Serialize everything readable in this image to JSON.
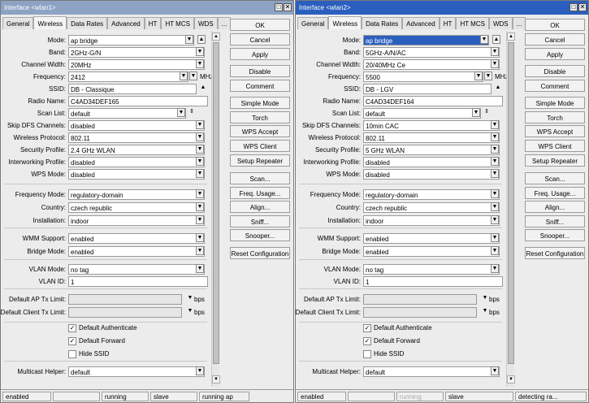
{
  "windows": [
    {
      "title": "Interface <wlan1>",
      "tabs": [
        "General",
        "Wireless",
        "Data Rates",
        "Advanced",
        "HT",
        "HT MCS",
        "WDS",
        "..."
      ],
      "active_tab": "Wireless",
      "fields": {
        "mode": {
          "label": "Mode:",
          "value": "ap bridge"
        },
        "band": {
          "label": "Band:",
          "value": "2GHz-G/N"
        },
        "channel_width": {
          "label": "Channel Width:",
          "value": "20MHz"
        },
        "frequency": {
          "label": "Frequency:",
          "value": "2412",
          "unit": "MHz"
        },
        "ssid": {
          "label": "SSID:",
          "value": "DB - Classique"
        },
        "radio_name": {
          "label": "Radio Name:",
          "value": "C4AD34DEF165"
        },
        "scan_list": {
          "label": "Scan List:",
          "value": "default"
        },
        "skip_dfs": {
          "label": "Skip DFS Channels:",
          "value": "disabled"
        },
        "wireless_protocol": {
          "label": "Wireless Protocol:",
          "value": "802.11"
        },
        "security_profile": {
          "label": "Security Profile:",
          "value": "2.4 GHz WLAN"
        },
        "interworking_profile": {
          "label": "Interworking Profile:",
          "value": "disabled"
        },
        "wps_mode": {
          "label": "WPS Mode:",
          "value": "disabled"
        },
        "frequency_mode": {
          "label": "Frequency Mode:",
          "value": "regulatory-domain"
        },
        "country": {
          "label": "Country:",
          "value": "czech republic"
        },
        "installation": {
          "label": "Installation:",
          "value": "indoor"
        },
        "wmm_support": {
          "label": "WMM Support:",
          "value": "enabled"
        },
        "bridge_mode": {
          "label": "Bridge Mode:",
          "value": "enabled"
        },
        "vlan_mode": {
          "label": "VLAN Mode:",
          "value": "no tag"
        },
        "vlan_id": {
          "label": "VLAN ID:",
          "value": "1"
        },
        "default_ap_tx_limit": {
          "label": "Default AP Tx Limit:",
          "value": "",
          "unit": "bps"
        },
        "default_client_tx_limit": {
          "label": "Default Client Tx Limit:",
          "value": "",
          "unit": "bps"
        },
        "multicast_helper": {
          "label": "Multicast Helper:",
          "value": "default"
        }
      },
      "checkboxes": {
        "default_authenticate": {
          "label": "Default Authenticate",
          "checked": true
        },
        "default_forward": {
          "label": "Default Forward",
          "checked": true
        },
        "hide_ssid": {
          "label": "Hide SSID",
          "checked": false
        }
      },
      "buttons": {
        "ok": "OK",
        "cancel": "Cancel",
        "apply": "Apply",
        "disable": "Disable",
        "comment": "Comment",
        "simple_mode": "Simple Mode",
        "torch": "Torch",
        "wps_accept": "WPS Accept",
        "wps_client": "WPS Client",
        "setup_repeater": "Setup Repeater",
        "scan": "Scan...",
        "freq_usage": "Freq. Usage...",
        "align": "Align...",
        "sniff": "Sniff...",
        "snooper": "Snooper...",
        "reset_configuration": "Reset Configuration"
      },
      "status": [
        "enabled",
        "",
        "running",
        "slave",
        "running ap"
      ]
    },
    {
      "title": "Interface <wlan2>",
      "tabs": [
        "General",
        "Wireless",
        "Data Rates",
        "Advanced",
        "HT",
        "HT MCS",
        "WDS",
        "..."
      ],
      "active_tab": "Wireless",
      "fields": {
        "mode": {
          "label": "Mode:",
          "value": "ap bridge"
        },
        "band": {
          "label": "Band:",
          "value": "5GHz-A/N/AC"
        },
        "channel_width": {
          "label": "Channel Width:",
          "value": "20/40MHz Ce"
        },
        "frequency": {
          "label": "Frequency:",
          "value": "5500",
          "unit": "MHz"
        },
        "ssid": {
          "label": "SSID:",
          "value": "DB - LGV"
        },
        "radio_name": {
          "label": "Radio Name:",
          "value": "C4AD34DEF164"
        },
        "scan_list": {
          "label": "Scan List:",
          "value": "default"
        },
        "skip_dfs": {
          "label": "Skip DFS Channels:",
          "value": "10min CAC"
        },
        "wireless_protocol": {
          "label": "Wireless Protocol:",
          "value": "802.11"
        },
        "security_profile": {
          "label": "Security Profile:",
          "value": "5 GHz WLAN"
        },
        "interworking_profile": {
          "label": "Interworking Profile:",
          "value": "disabled"
        },
        "wps_mode": {
          "label": "WPS Mode:",
          "value": "disabled"
        },
        "frequency_mode": {
          "label": "Frequency Mode:",
          "value": "regulatory-domain"
        },
        "country": {
          "label": "Country:",
          "value": "czech republic"
        },
        "installation": {
          "label": "Installation:",
          "value": "indoor"
        },
        "wmm_support": {
          "label": "WMM Support:",
          "value": "enabled"
        },
        "bridge_mode": {
          "label": "Bridge Mode:",
          "value": "enabled"
        },
        "vlan_mode": {
          "label": "VLAN Mode:",
          "value": "no tag"
        },
        "vlan_id": {
          "label": "VLAN ID:",
          "value": "1"
        },
        "default_ap_tx_limit": {
          "label": "Default AP Tx Limit:",
          "value": "",
          "unit": "bps"
        },
        "default_client_tx_limit": {
          "label": "Default Client Tx Limit:",
          "value": "",
          "unit": "bps"
        },
        "multicast_helper": {
          "label": "Multicast Helper:",
          "value": "default"
        }
      },
      "checkboxes": {
        "default_authenticate": {
          "label": "Default Authenticate",
          "checked": true
        },
        "default_forward": {
          "label": "Default Forward",
          "checked": true
        },
        "hide_ssid": {
          "label": "Hide SSID",
          "checked": false
        }
      },
      "buttons": {
        "ok": "OK",
        "cancel": "Cancel",
        "apply": "Apply",
        "disable": "Disable",
        "comment": "Comment",
        "simple_mode": "Simple Mode",
        "torch": "Torch",
        "wps_accept": "WPS Accept",
        "wps_client": "WPS Client",
        "setup_repeater": "Setup Repeater",
        "scan": "Scan...",
        "freq_usage": "Freq. Usage...",
        "align": "Align...",
        "sniff": "Sniff...",
        "snooper": "Snooper...",
        "reset_configuration": "Reset Configuration"
      },
      "status": [
        "enabled",
        "running",
        "slave",
        "detecting ra..."
      ]
    }
  ],
  "icons": {
    "dropdown": "▼",
    "minimize": "□",
    "close": "✕",
    "up": "▲",
    "down": "▼",
    "updown": "⇕",
    "checkmark": "✓"
  },
  "colors": {
    "title_inactive": "#8da3c4",
    "title_active": "#2a5fbe",
    "selection": "#2a5fbe"
  }
}
